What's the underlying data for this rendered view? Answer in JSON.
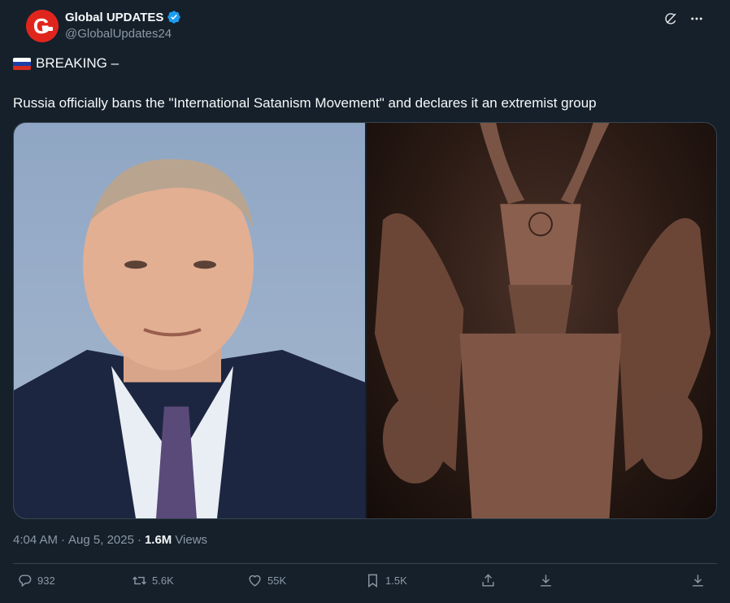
{
  "author": {
    "display_name": "Global UPDATES",
    "handle": "@GlobalUpdates24",
    "avatar_letter": "G",
    "verified": true
  },
  "tweet": {
    "line1": "BREAKING –",
    "line2": "Russia officially bans the \"International Satanism Movement\" and declares it an extremist group",
    "flag_icon": "russia-flag-icon"
  },
  "meta": {
    "time": "4:04 AM",
    "separator": "·",
    "date": "Aug 5, 2025",
    "views_count": "1.6M",
    "views_label": "Views"
  },
  "actions": {
    "replies": "932",
    "retweets": "5.6K",
    "likes": "55K",
    "bookmarks": "1.5K"
  },
  "colors": {
    "background": "#15202b",
    "text": "#f7f9f9",
    "muted": "#8b98a5",
    "border": "#38444d",
    "verified": "#1d9bf0",
    "avatar": "#e0261c"
  }
}
